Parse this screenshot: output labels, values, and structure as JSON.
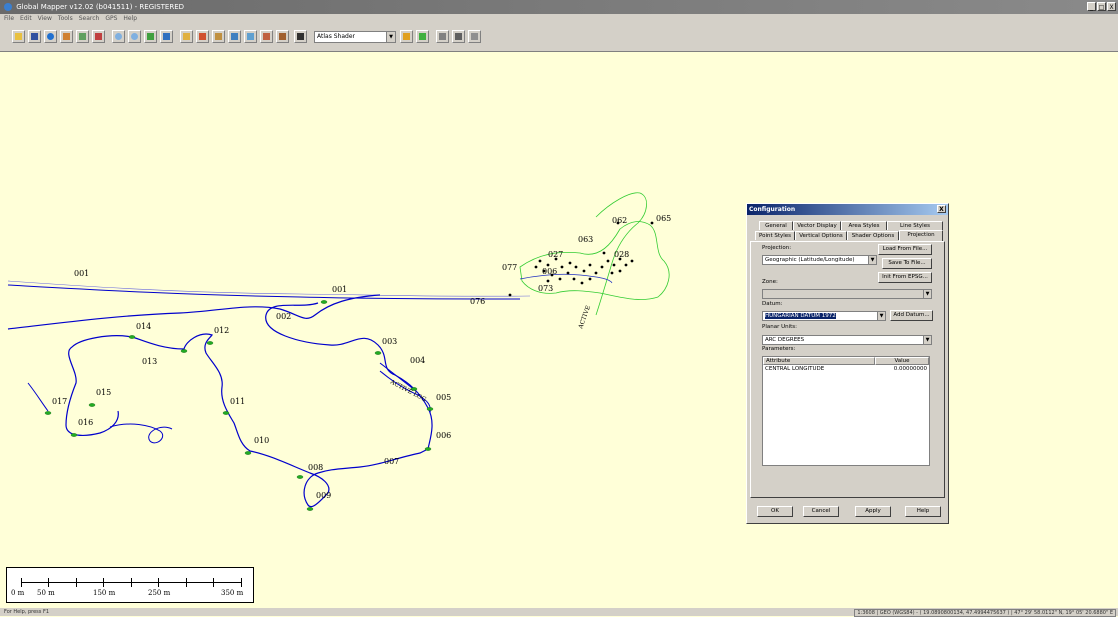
{
  "window": {
    "title": "Global Mapper v12.02 (b041511) - REGISTERED",
    "controls": [
      "_",
      "□",
      "X"
    ]
  },
  "menu": [
    "File",
    "Edit",
    "View",
    "Tools",
    "Search",
    "GPS",
    "Help"
  ],
  "toolbar": {
    "shader_select": "Atlas Shader"
  },
  "map": {
    "background": "#ffffd8",
    "track_color": "#0000cc",
    "green_track_color": "#33cc33",
    "waypoints": [
      {
        "label": "001"
      },
      {
        "label": "001"
      },
      {
        "label": "002"
      },
      {
        "label": "003"
      },
      {
        "label": "004"
      },
      {
        "label": "005"
      },
      {
        "label": "006"
      },
      {
        "label": "007"
      },
      {
        "label": "008"
      },
      {
        "label": "009"
      },
      {
        "label": "010"
      },
      {
        "label": "011"
      },
      {
        "label": "012"
      },
      {
        "label": "013"
      },
      {
        "label": "014"
      },
      {
        "label": "015"
      },
      {
        "label": "016"
      },
      {
        "label": "017"
      },
      {
        "label": "027"
      },
      {
        "label": "028"
      },
      {
        "label": "062"
      },
      {
        "label": "063"
      },
      {
        "label": "065"
      },
      {
        "label": "073"
      },
      {
        "label": "076"
      },
      {
        "label": "077"
      },
      {
        "label": "006"
      }
    ],
    "track_labels": [
      "ACTIVE LOG",
      "ACTIVE"
    ]
  },
  "scalebar": {
    "labels": [
      "0 m",
      "50 m",
      "150 m",
      "250 m",
      "350 m"
    ]
  },
  "status": {
    "left": "For Help, press F1",
    "right": "1:3608 | GEO (WGS84) - ( 19.0890800134, 47.4994475637 ) | 47° 29' 58.0112\" N, 19° 05' 20.6880\" E"
  },
  "dialog": {
    "title": "Configuration",
    "close": "X",
    "tabs_row1": [
      "General",
      "Vector Display",
      "Area Styles",
      "Line Styles"
    ],
    "tabs_row2": [
      "Point Styles",
      "Vertical Options",
      "Shader Options",
      "Projection"
    ],
    "projection_label": "Projection:",
    "projection_value": "Geographic (Latitude/Longitude)",
    "load_button": "Load From File...",
    "save_button": "Save To File...",
    "epsg_button": "Init From EPSG...",
    "zone_label": "Zone:",
    "datum_label": "Datum:",
    "datum_value": "HUNGARIAN DATUM 1972",
    "add_datum_button": "Add Datum...",
    "units_label": "Planar Units:",
    "units_value": "ARC DEGREES",
    "params_label": "Parameters:",
    "params_headers": [
      "Attribute",
      "Value"
    ],
    "params_rows": [
      {
        "attribute": "CENTRAL LONGITUDE",
        "value": "0.00000000"
      }
    ],
    "ok": "OK",
    "cancel": "Cancel",
    "apply": "Apply",
    "help": "Help"
  }
}
